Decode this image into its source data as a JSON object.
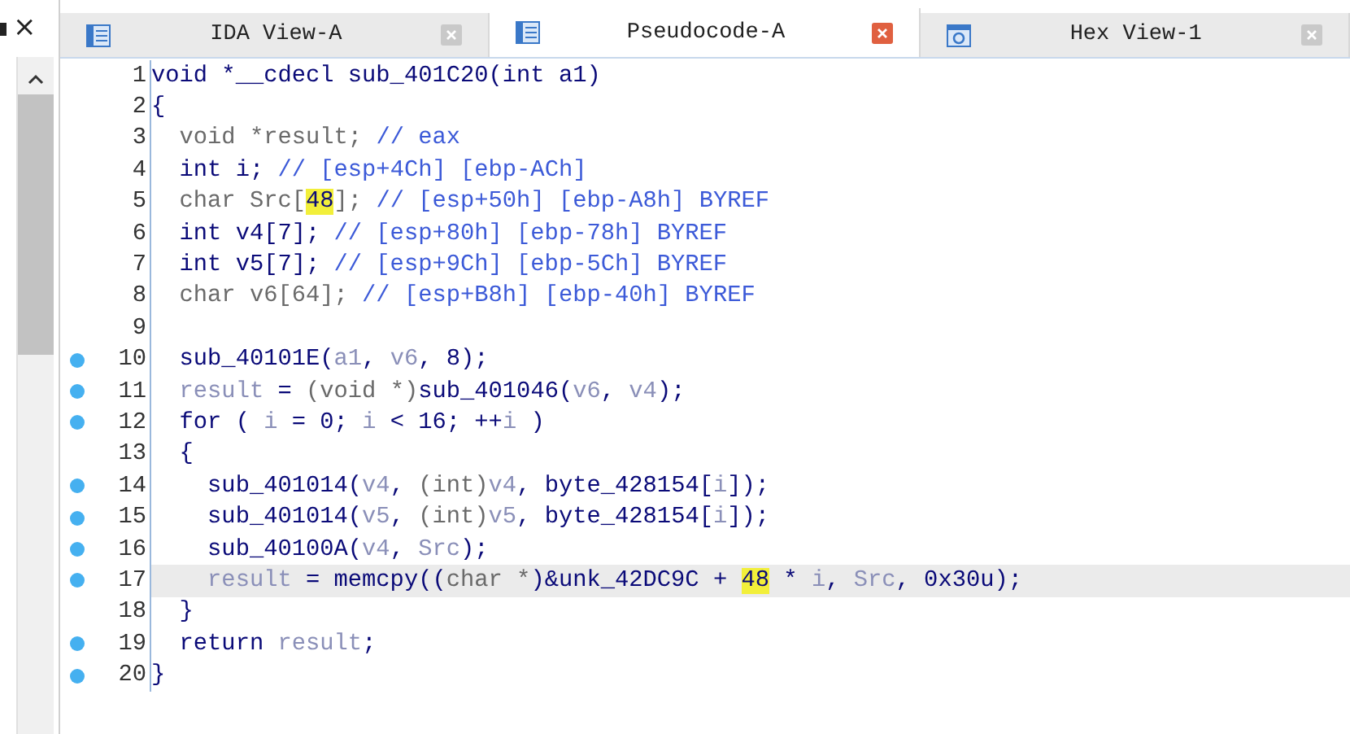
{
  "side_panel": {
    "close": "×"
  },
  "tabs": [
    {
      "label": "IDA View-A",
      "selected": false
    },
    {
      "label": "Pseudocode-A",
      "selected": true
    },
    {
      "label": "Hex View-1",
      "selected": false
    }
  ],
  "code": [
    {
      "number": "1",
      "breakpoint": false,
      "selected": false,
      "tokens": [
        {
          "kind": "ident",
          "text": "void *__cdecl sub_401C20(int a1)"
        }
      ]
    },
    {
      "number": "2",
      "breakpoint": false,
      "selected": false,
      "tokens": [
        {
          "kind": "ident",
          "text": "{"
        }
      ]
    },
    {
      "number": "3",
      "breakpoint": false,
      "selected": false,
      "tokens": [
        {
          "kind": "type",
          "text": "  void *result; "
        },
        {
          "kind": "comment",
          "text": "// eax"
        }
      ]
    },
    {
      "number": "4",
      "breakpoint": false,
      "selected": false,
      "tokens": [
        {
          "kind": "ident",
          "text": "  int i; "
        },
        {
          "kind": "comment",
          "text": "// [esp+4Ch] [ebp-ACh]"
        }
      ]
    },
    {
      "number": "5",
      "breakpoint": false,
      "selected": false,
      "tokens": [
        {
          "kind": "type",
          "text": "  char Src["
        },
        {
          "kind": "highlight",
          "text": "48"
        },
        {
          "kind": "type",
          "text": "]; "
        },
        {
          "kind": "comment",
          "text": "// [esp+50h] [ebp-A8h] BYREF"
        }
      ]
    },
    {
      "number": "6",
      "breakpoint": false,
      "selected": false,
      "tokens": [
        {
          "kind": "ident",
          "text": "  int v4[7]; "
        },
        {
          "kind": "comment",
          "text": "// [esp+80h] [ebp-78h] BYREF"
        }
      ]
    },
    {
      "number": "7",
      "breakpoint": false,
      "selected": false,
      "tokens": [
        {
          "kind": "ident",
          "text": "  int v5[7]; "
        },
        {
          "kind": "comment",
          "text": "// [esp+9Ch] [ebp-5Ch] BYREF"
        }
      ]
    },
    {
      "number": "8",
      "breakpoint": false,
      "selected": false,
      "tokens": [
        {
          "kind": "type",
          "text": "  char v6[64]; "
        },
        {
          "kind": "comment",
          "text": "// [esp+B8h] [ebp-40h] BYREF"
        }
      ]
    },
    {
      "number": "9",
      "breakpoint": false,
      "selected": false
    },
    {
      "number": "10",
      "breakpoint": true,
      "selected": false,
      "tokens": [
        {
          "kind": "ident",
          "text": "  sub_40101E("
        },
        {
          "kind": "local",
          "text": "a1"
        },
        {
          "kind": "ident",
          "text": ", "
        },
        {
          "kind": "local",
          "text": "v6"
        },
        {
          "kind": "ident",
          "text": ", 8);"
        }
      ]
    },
    {
      "number": "11",
      "breakpoint": true,
      "selected": false,
      "tokens": [
        {
          "kind": "local",
          "text": "  result"
        },
        {
          "kind": "ident",
          "text": " = "
        },
        {
          "kind": "type",
          "text": "(void *)"
        },
        {
          "kind": "ident",
          "text": "sub_401046("
        },
        {
          "kind": "local",
          "text": "v6"
        },
        {
          "kind": "ident",
          "text": ", "
        },
        {
          "kind": "local",
          "text": "v4"
        },
        {
          "kind": "ident",
          "text": ");"
        }
      ]
    },
    {
      "number": "12",
      "breakpoint": true,
      "selected": false,
      "tokens": [
        {
          "kind": "ident",
          "text": "  for ( "
        },
        {
          "kind": "local",
          "text": "i"
        },
        {
          "kind": "ident",
          "text": " = 0; "
        },
        {
          "kind": "local",
          "text": "i"
        },
        {
          "kind": "ident",
          "text": " < 16; ++"
        },
        {
          "kind": "local",
          "text": "i"
        },
        {
          "kind": "ident",
          "text": " )"
        }
      ]
    },
    {
      "number": "13",
      "breakpoint": false,
      "selected": false,
      "tokens": [
        {
          "kind": "ident",
          "text": "  {"
        }
      ]
    },
    {
      "number": "14",
      "breakpoint": true,
      "selected": false,
      "tokens": [
        {
          "kind": "ident",
          "text": "    sub_401014("
        },
        {
          "kind": "local",
          "text": "v4"
        },
        {
          "kind": "ident",
          "text": ", "
        },
        {
          "kind": "type",
          "text": "(int)"
        },
        {
          "kind": "local",
          "text": "v4"
        },
        {
          "kind": "ident",
          "text": ", byte_428154["
        },
        {
          "kind": "local",
          "text": "i"
        },
        {
          "kind": "ident",
          "text": "]);"
        }
      ]
    },
    {
      "number": "15",
      "breakpoint": true,
      "selected": false,
      "tokens": [
        {
          "kind": "ident",
          "text": "    sub_401014("
        },
        {
          "kind": "local",
          "text": "v5"
        },
        {
          "kind": "ident",
          "text": ", "
        },
        {
          "kind": "type",
          "text": "(int)"
        },
        {
          "kind": "local",
          "text": "v5"
        },
        {
          "kind": "ident",
          "text": ", byte_428154["
        },
        {
          "kind": "local",
          "text": "i"
        },
        {
          "kind": "ident",
          "text": "]);"
        }
      ]
    },
    {
      "number": "16",
      "breakpoint": true,
      "selected": false,
      "tokens": [
        {
          "kind": "ident",
          "text": "    sub_40100A("
        },
        {
          "kind": "local",
          "text": "v4"
        },
        {
          "kind": "ident",
          "text": ", "
        },
        {
          "kind": "local",
          "text": "Src"
        },
        {
          "kind": "ident",
          "text": ");"
        }
      ]
    },
    {
      "number": "17",
      "breakpoint": true,
      "selected": true,
      "tokens": [
        {
          "kind": "local",
          "text": "    result"
        },
        {
          "kind": "ident",
          "text": " = memcpy(("
        },
        {
          "kind": "type",
          "text": "char *"
        },
        {
          "kind": "ident",
          "text": ")&unk_42DC9C + "
        },
        {
          "kind": "highlight",
          "text": "48"
        },
        {
          "kind": "ident",
          "text": " * "
        },
        {
          "kind": "local",
          "text": "i"
        },
        {
          "kind": "ident",
          "text": ", "
        },
        {
          "kind": "local",
          "text": "Src"
        },
        {
          "kind": "ident",
          "text": ", 0x30u);"
        }
      ]
    },
    {
      "number": "18",
      "breakpoint": false,
      "selected": false,
      "tokens": [
        {
          "kind": "ident",
          "text": "  }"
        }
      ]
    },
    {
      "number": "19",
      "breakpoint": true,
      "selected": false,
      "tokens": [
        {
          "kind": "ident",
          "text": "  return "
        },
        {
          "kind": "local",
          "text": "result"
        },
        {
          "kind": "ident",
          "text": ";"
        }
      ]
    },
    {
      "number": "20",
      "breakpoint": true,
      "selected": false,
      "tokens": [
        {
          "kind": "ident",
          "text": "}"
        }
      ]
    }
  ]
}
